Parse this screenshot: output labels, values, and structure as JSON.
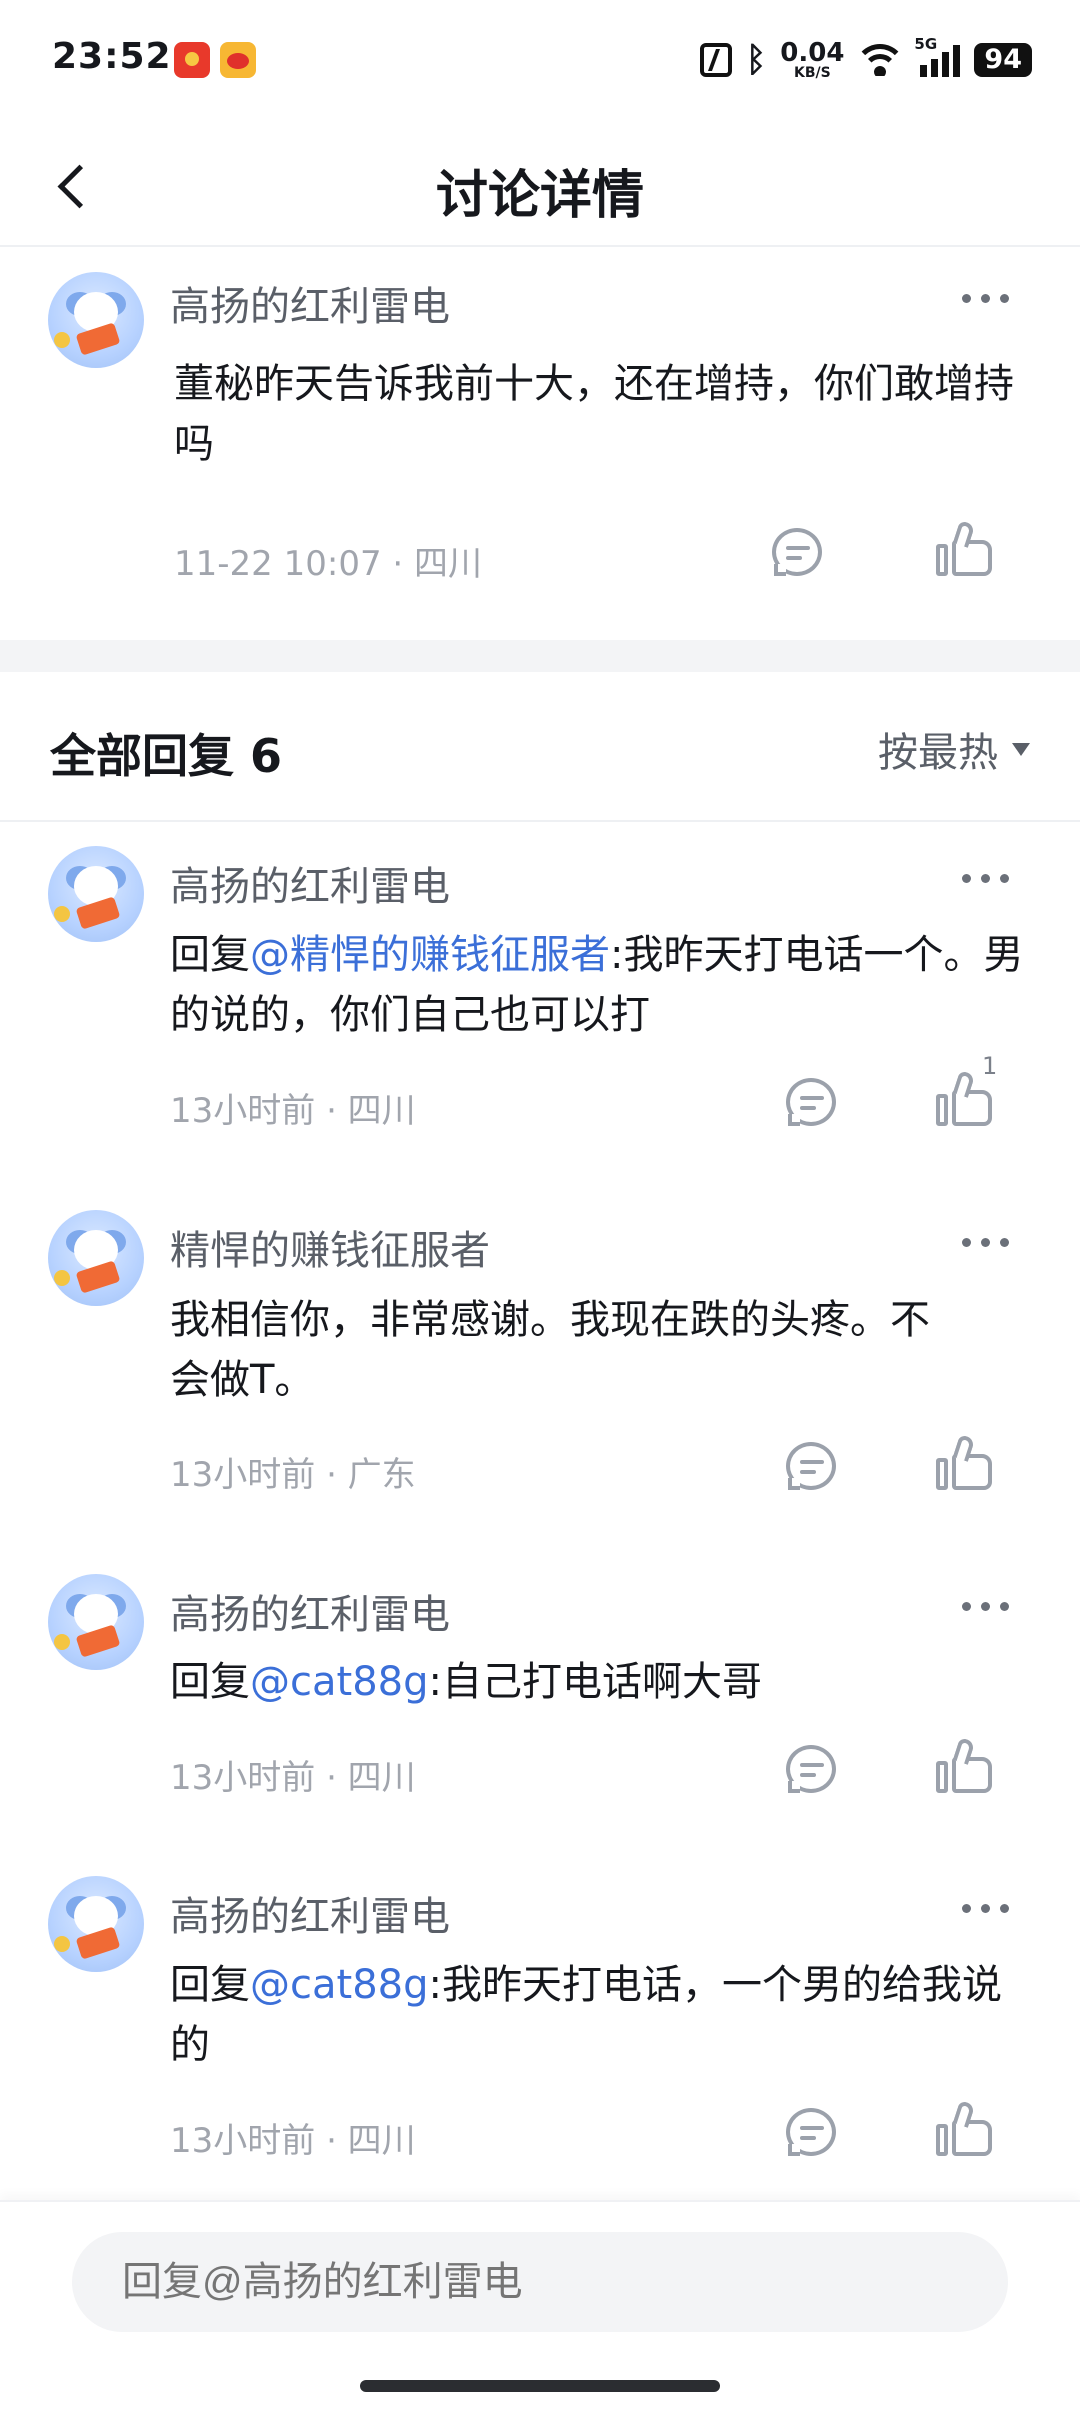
{
  "status_bar": {
    "time": "23:52",
    "speed_value": "0.04",
    "speed_unit": "KB/S",
    "network": "5G",
    "battery": "94"
  },
  "header": {
    "title": "讨论详情"
  },
  "main_post": {
    "username": "高扬的红利雷电",
    "content": "董秘昨天告诉我前十大，还在增持，你们敢增持吗",
    "meta": "11-22 10:07 · 四川"
  },
  "replies_section": {
    "title": "全部回复 6",
    "sort_label": "按最热"
  },
  "replies": [
    {
      "username": "高扬的红利雷电",
      "prefix": "回复",
      "mention": "@精悍的赚钱征服者",
      "text": ":我昨天打电话一个。男的说的，你们自己也可以打",
      "meta": "13小时前 · 四川",
      "likes": "1"
    },
    {
      "username": "精悍的赚钱征服者",
      "prefix": "",
      "mention": "",
      "text": "我相信你，非常感谢。我现在跌的头疼。不会做T。",
      "meta": "13小时前 · 广东",
      "likes": ""
    },
    {
      "username": "高扬的红利雷电",
      "prefix": "回复",
      "mention": "@cat88g",
      "text": ":自己打电话啊大哥",
      "meta": "13小时前 · 四川",
      "likes": ""
    },
    {
      "username": "高扬的红利雷电",
      "prefix": "回复",
      "mention": "@cat88g",
      "text": ":我昨天打电话，一个男的给我说的",
      "meta": "13小时前 · 四川",
      "likes": ""
    }
  ],
  "reply_input": {
    "placeholder": "回复@高扬的红利雷电"
  },
  "colors": {
    "mention": "#3b6fd8",
    "meta": "#a1a5ad",
    "icon": "#9ba1ab"
  }
}
